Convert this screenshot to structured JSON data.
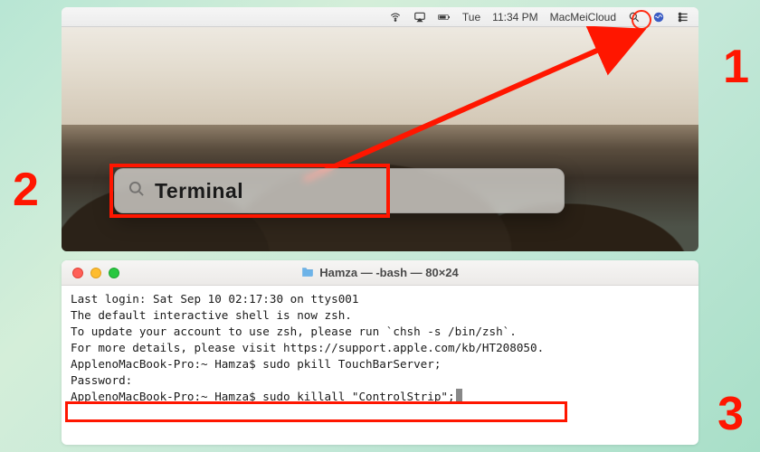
{
  "annotations": {
    "step1": "1",
    "step2": "2",
    "step3": "3"
  },
  "menubar": {
    "day": "Tue",
    "time": "11:34 PM",
    "account": "MacMeiCloud"
  },
  "spotlight": {
    "query": "Terminal"
  },
  "terminal": {
    "title": "Hamza — -bash — 80×24",
    "lines": [
      "Last login: Sat Sep 10 02:17:30 on ttys001",
      "",
      "The default interactive shell is now zsh.",
      "To update your account to use zsh, please run `chsh -s /bin/zsh`.",
      "For more details, please visit https://support.apple.com/kb/HT208050.",
      "ApplenoMacBook-Pro:~ Hamza$ sudo pkill TouchBarServer;",
      "Password:",
      "ApplenoMacBook-Pro:~ Hamza$ sudo killall \"ControlStrip\";"
    ]
  }
}
